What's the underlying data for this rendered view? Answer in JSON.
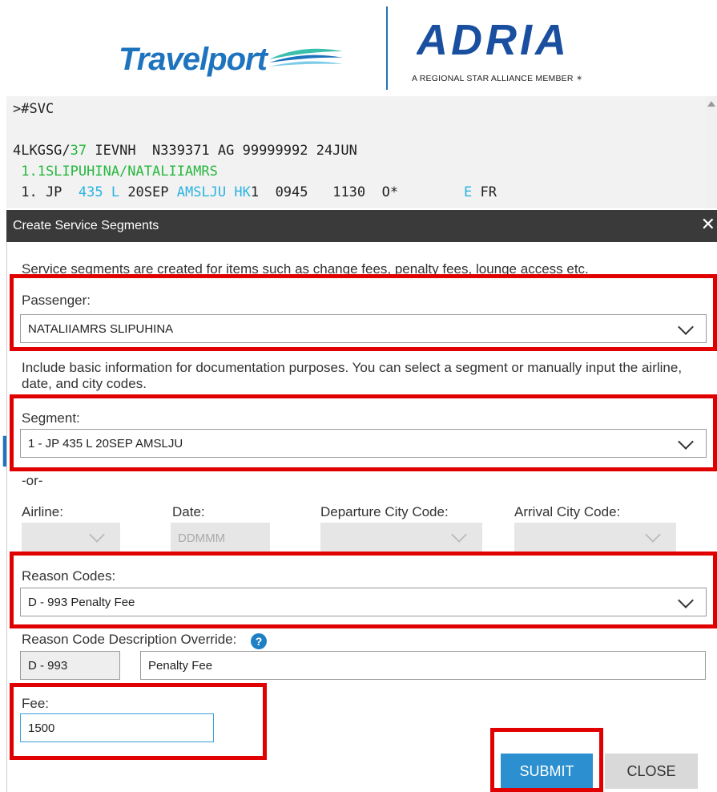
{
  "branding": {
    "travelport": "Travelport",
    "adria": "ADRIA",
    "adria_tagline": "A REGIONAL STAR ALLIANCE MEMBER",
    "background_letter": "R"
  },
  "terminal": {
    "line1": ">#SVC",
    "line2_a": "4LKGSG/",
    "line2_b": "37",
    "line2_c": " IEVNH  N339371 AG 99999992 24JUN",
    "line3": " 1.1SLIPUHINA/NATALIIAMRS",
    "line4_a": " 1. JP  ",
    "line4_b": "435 L",
    "line4_c": " 20SEP ",
    "line4_d": "AMSLJU HK",
    "line4_e": "1  0945   1130  O*        ",
    "line4_f": "E",
    "line4_g": " FR"
  },
  "dialog": {
    "title": "Create Service Segments",
    "close_icon": "close-icon",
    "intro": "Service segments are created for items such as change fees, penalty fees, lounge access etc.",
    "passenger_label": "Passenger:",
    "passenger_value": "NATALIIAMRS SLIPUHINA",
    "info_text": "Include basic information for documentation purposes. You can select a segment or manually input the airline, date, and city codes.",
    "segment_label": "Segment:",
    "segment_value": "1 - JP 435 L 20SEP AMSLJU",
    "or_text": "-or-",
    "airline_label": "Airline:",
    "date_label": "Date:",
    "date_placeholder": "DDMMM",
    "departure_label": "Departure City Code:",
    "arrival_label": "Arrival City Code:",
    "reason_label": "Reason Codes:",
    "reason_value": "D - 993 Penalty Fee",
    "override_label": "Reason Code Description Override:",
    "override_code": "D - 993",
    "override_desc": "Penalty Fee",
    "fee_label": "Fee:",
    "fee_value": "1500",
    "submit_label": "SUBMIT",
    "close_label": "CLOSE"
  },
  "colors": {
    "highlight": "#e00000",
    "accent": "#2b8fd0",
    "brand_blue": "#1e73be",
    "terminal_green": "#27b83e",
    "terminal_cyan": "#2bb3e0"
  }
}
